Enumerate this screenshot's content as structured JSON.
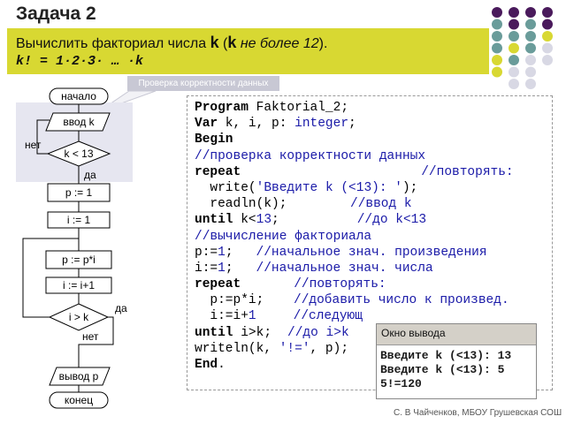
{
  "title": "Задача 2",
  "task": {
    "text_prefix": "Вычислить факториал числа ",
    "var": "k",
    "paren_open": "  (",
    "paren_var": "k",
    "paren_rest": " не более 12",
    "paren_close": ").",
    "formula": "k! = 1·2·3· … ·k"
  },
  "callout": "Проверка корректности данных",
  "flowchart": {
    "start": "начало",
    "input": "ввод k",
    "cond1": "k < 13",
    "cond1_no": "нет",
    "cond1_yes": "да",
    "init_p": "p := 1",
    "init_i": "i := 1",
    "mult": "p := p*i",
    "inc": "i := i+1",
    "cond2": "i > k",
    "cond2_yes": "да",
    "cond2_no": "нет",
    "output": "вывод p",
    "end": "конец"
  },
  "code": {
    "l1_kw": "Program",
    "l1_rest": " Faktorial_2;",
    "l2_kw": "Var",
    "l2_rest": " k, i, p: ",
    "l2_type": "integer",
    "l2_end": ";",
    "l3_kw": "Begin",
    "l4_cm": "//проверка корректности данных",
    "l5_kw": "repeat",
    "l5_cm": "//повторять:",
    "l6_a": "  write(",
    "l6_str": "'Введите k (<13): '",
    "l6_b": ");",
    "l7_a": "  readln(k);",
    "l7_cm": "//ввод k",
    "l8_kw": "until",
    "l8_a": " k<",
    "l8_num": "13",
    "l8_b": ";",
    "l8_cm": "//до k<13",
    "l9_cm": "//вычисление факториала",
    "l10_a": "p:=",
    "l10_num": "1",
    "l10_b": ";",
    "l10_cm": "//начальное знач. произведения",
    "l11_a": "i:=",
    "l11_num": "1",
    "l11_b": ";",
    "l11_cm": "//начальное знач. числа",
    "l12_kw": "repeat",
    "l12_cm": "//повторять:",
    "l13_a": "  p:=p*i;",
    "l13_cm": "//добавить число к произвед.",
    "l14_a": "  i:=i+",
    "l14_num": "1",
    "l14_cm": "//следующ",
    "l15_kw": "until",
    "l15_a": " i>k;",
    "l15_cm": "//до i>k",
    "l16_a": "writeln(k, ",
    "l16_str": "'!='",
    "l16_b": ", p);",
    "l17_kw": "End",
    "l17_b": "."
  },
  "output_window": {
    "title": "Окно вывода",
    "lines": [
      "Введите k (<13): 13",
      "Введите k (<13): 5",
      "5!=120"
    ]
  },
  "footer": "С. В Чайченков, МБОУ Грушевская СОШ",
  "colors": {
    "task_bg": "#d8d832",
    "dot_purple": "#4a1a5c",
    "dot_teal": "#6a9c9a",
    "dot_yellow": "#d8d832",
    "dot_light": "#d8d8e4"
  }
}
